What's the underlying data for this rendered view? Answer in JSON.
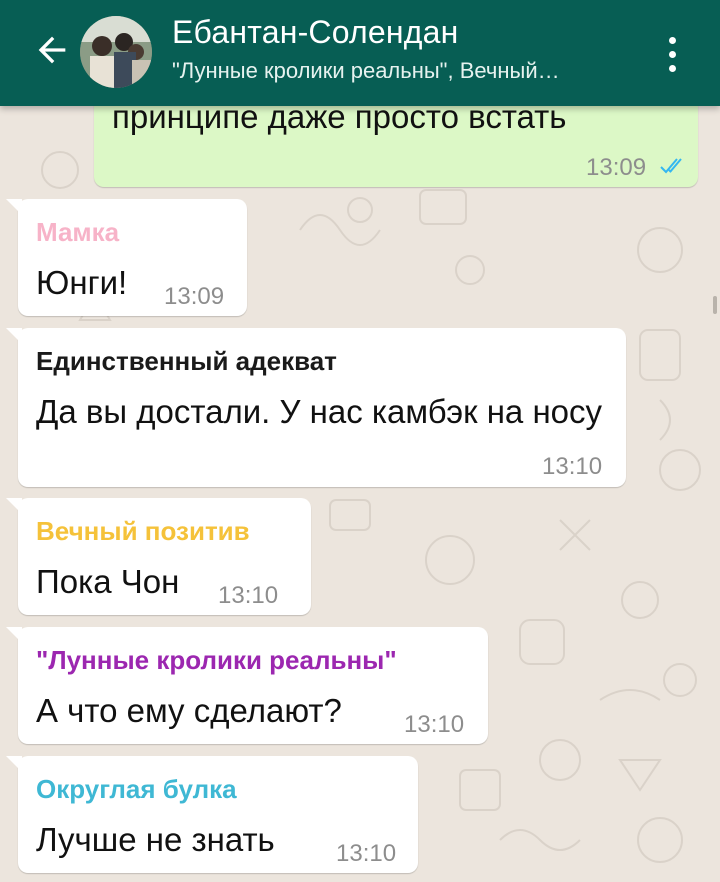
{
  "header": {
    "title": "Ебантан-Солендан",
    "subtitle": "\"Лунные кролики реальны\", Вечный…",
    "back_icon": "arrow-left-icon",
    "menu_icon": "more-vertical-icon"
  },
  "colors": {
    "appbar": "#075e54",
    "incoming_bubble": "#ffffff",
    "outgoing_bubble": "#dcf8c6",
    "read_ticks": "#34b7f1"
  },
  "messages": [
    {
      "direction": "out",
      "text": "принципе даже просто встать",
      "time": "13:09",
      "status_icon": "double-check-read-icon"
    },
    {
      "direction": "in",
      "sender": "Мамка",
      "sender_color": "#f7b3c8",
      "text": "Юнги!",
      "time": "13:09"
    },
    {
      "direction": "in",
      "sender": "Единственный адекват",
      "sender_color": "#1a1a1a",
      "text": "Да вы достали. У нас камбэк на носу",
      "time": "13:10"
    },
    {
      "direction": "in",
      "sender": "Вечный позитив",
      "sender_color": "#f5c23a",
      "text": "Пока Чон",
      "time": "13:10"
    },
    {
      "direction": "in",
      "sender": "\"Лунные кролики реальны\"",
      "sender_color": "#9c27b0",
      "text": "А что ему сделают?",
      "time": "13:10"
    },
    {
      "direction": "in",
      "sender": "Округлая булка",
      "sender_color": "#3fb8d4",
      "text": "Лучше не знать",
      "time": "13:10"
    }
  ]
}
